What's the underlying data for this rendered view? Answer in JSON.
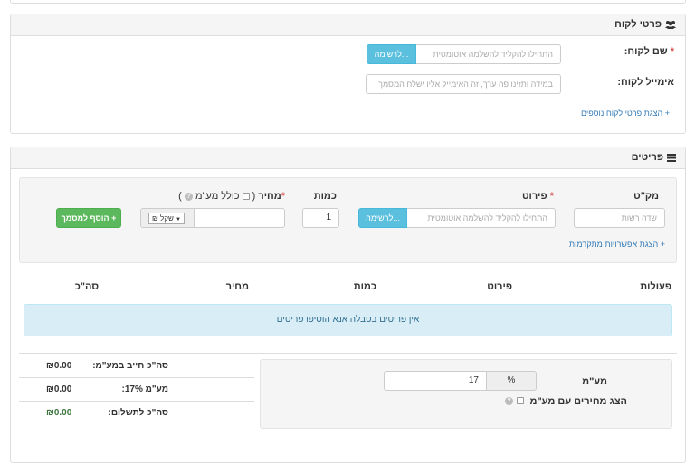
{
  "customer": {
    "title": "פרטי לקוח",
    "name_label": "שם לקוח:",
    "name_required": "*",
    "name_placeholder": "התחילו להקליד להשלמה אוטומטית",
    "list_button": "לרשימה...",
    "email_label": "אימייל לקוח:",
    "email_placeholder": "במידה ותזינו פה ערך, זה האימייל אליו ישלח המסמך",
    "more_details_link": "+ הצגת פרטי לקוח נוספים"
  },
  "items": {
    "title": "פריטים",
    "sku_label": "מק\"ט",
    "sku_placeholder": "שדה רשות",
    "desc_label": "פירוט",
    "desc_required": "*",
    "desc_placeholder": "התחילו להקליד להשלמה אוטומטית",
    "list_button": "לרשימה...",
    "qty_label": "כמות",
    "qty_value": "1",
    "price_label": "מחיר",
    "price_required": "*",
    "incl_vat_open": "(",
    "incl_vat_label": "כולל מע\"מ",
    "incl_vat_close": ")",
    "currency_select": "₪ שקל",
    "currency_arrow": "▼",
    "add_button": "הוסף למסמך",
    "add_icon": "+",
    "advanced_link": "+ הצגת אפשרויות מתקדמות"
  },
  "table": {
    "columns": [
      "פעולות",
      "פירוט",
      "כמות",
      "מחיר",
      "סה\"כ"
    ],
    "empty_message": "אין פריטים בטבלה אנא הוסיפו פריטים"
  },
  "vat": {
    "label": "מע\"מ",
    "percent_symbol": "%",
    "rate_value": "17",
    "show_prices_label": "הצג מחירים עם מע\"מ"
  },
  "totals": {
    "rows": [
      {
        "label": "סה\"כ חייב במע\"מ:",
        "value": "₪0.00"
      },
      {
        "label": "מע\"מ 17%:",
        "value": "₪0.00"
      },
      {
        "label": "סה\"כ לתשלום:",
        "value": "₪0.00"
      }
    ]
  },
  "colors": {
    "info_button": "#5bc0de",
    "success_button": "#5cb85c",
    "link": "#337ab7",
    "alert_bg": "#d9edf7",
    "total_value_green": "#3c763d"
  },
  "icons": {
    "customer": "users-icon",
    "items": "list-icon",
    "help": "question-icon"
  }
}
